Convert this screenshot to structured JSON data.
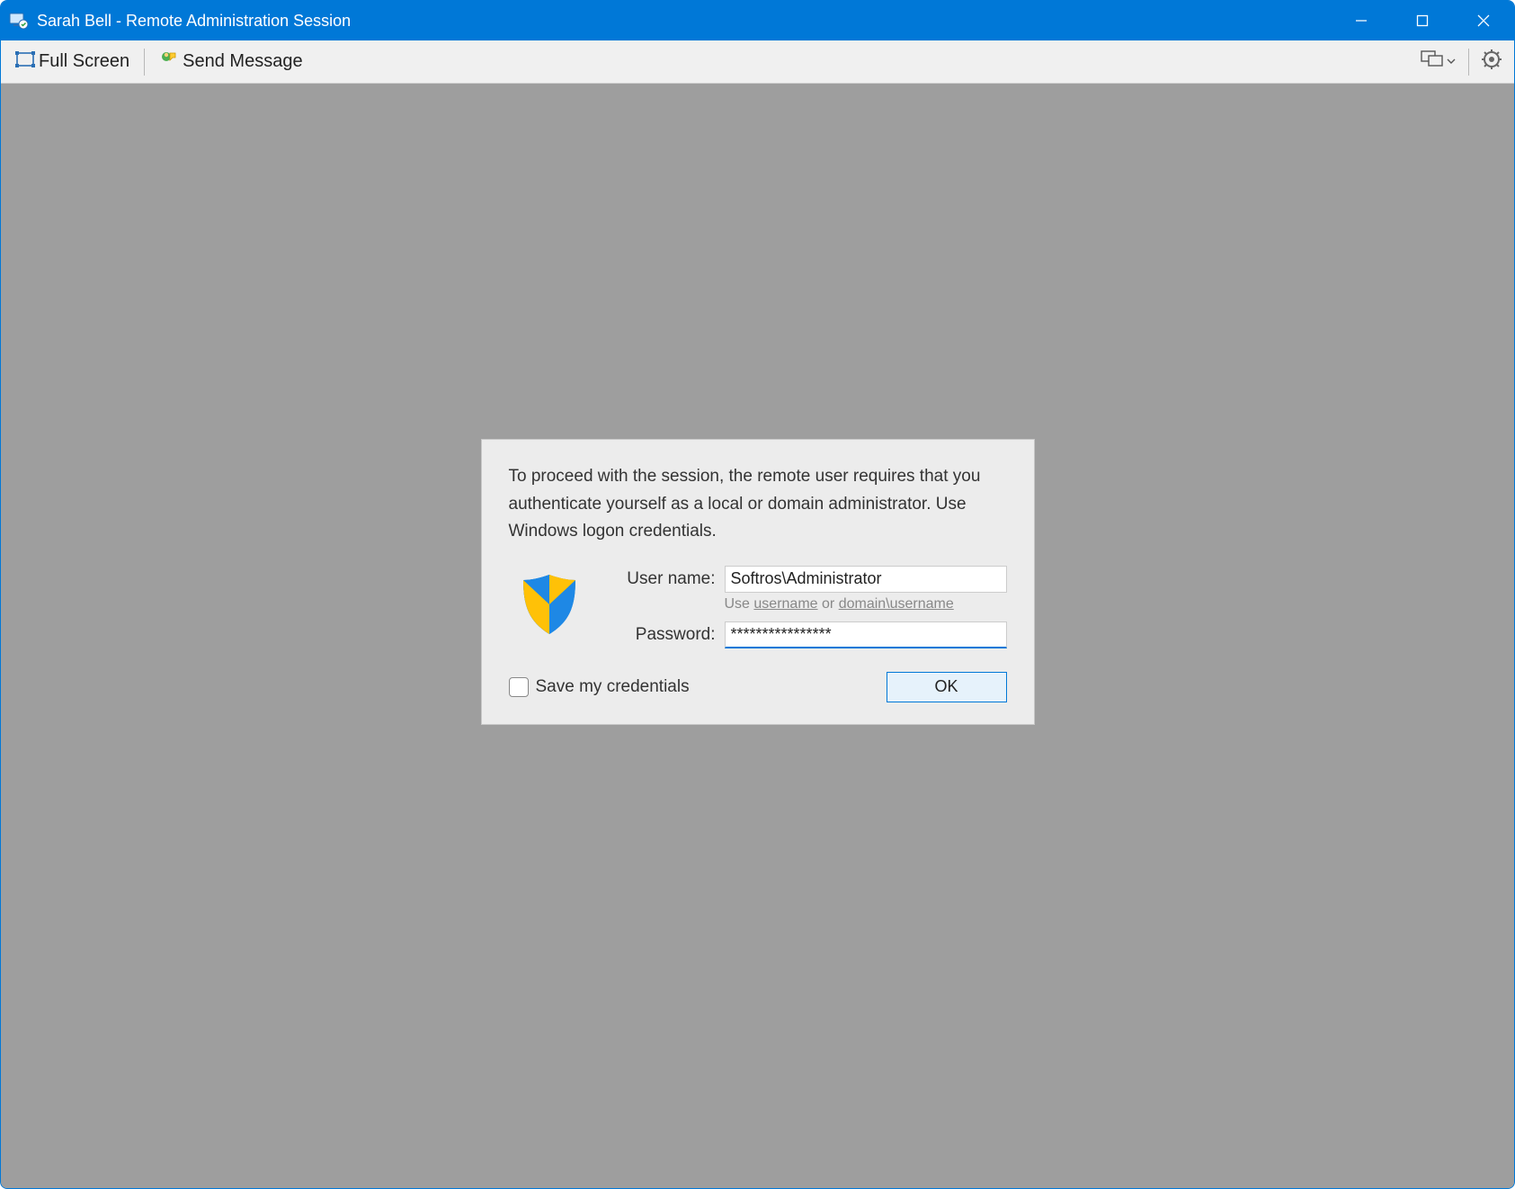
{
  "window": {
    "title": "Sarah Bell - Remote Administration Session"
  },
  "toolbar": {
    "full_screen": "Full Screen",
    "send_message": "Send Message"
  },
  "auth": {
    "message": "To proceed with the session, the remote user requires that you authenticate yourself as a local or domain administrator. Use Windows logon credentials.",
    "username_label": "User name:",
    "username_value": "Softros\\Administrator",
    "hint_prefix": "Use ",
    "hint_link1": "username",
    "hint_mid": " or ",
    "hint_link2": "domain\\username",
    "password_label": "Password:",
    "password_value": "****************",
    "save_label": "Save my credentials",
    "ok_label": "OK"
  }
}
